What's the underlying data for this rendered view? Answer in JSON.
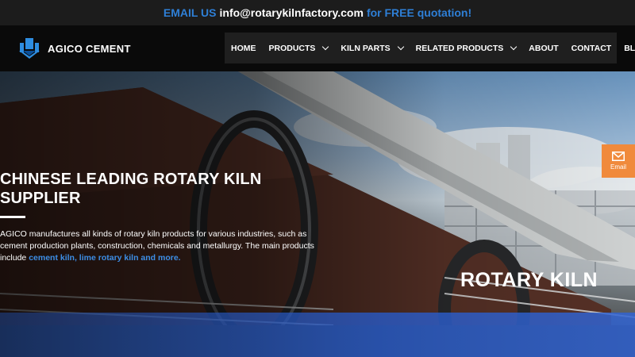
{
  "topbar": {
    "prefix": "EMAIL US",
    "email": "info@rotarykilnfactory.com",
    "suffix": "for FREE quotation!"
  },
  "header": {
    "logo_text": "AGICO CEMENT",
    "nav": [
      {
        "label": "HOME",
        "dropdown": false
      },
      {
        "label": "PRODUCTS",
        "dropdown": true
      },
      {
        "label": "KILN PARTS",
        "dropdown": true
      },
      {
        "label": "RELATED PRODUCTS",
        "dropdown": true
      },
      {
        "label": "ABOUT",
        "dropdown": false
      },
      {
        "label": "CONTACT",
        "dropdown": false
      },
      {
        "label": "BLOG",
        "dropdown": false
      }
    ]
  },
  "hero": {
    "title": "CHINESE LEADING ROTARY KILN SUPPLIER",
    "desc_text": "AGICO manufactures all kinds of rotary kiln products for various industries, such as cement production plants, construction, chemicals and metallurgy. The main products include ",
    "desc_link": "cement kiln, lime rotary kiln and more.",
    "band_title": "ROTARY KILN"
  },
  "float_button": {
    "label": "Email",
    "icon": "envelope-icon"
  },
  "colors": {
    "accent_blue": "#2e7fd6",
    "float_orange": "#f08a3c",
    "link_blue": "#3d8ee6"
  }
}
